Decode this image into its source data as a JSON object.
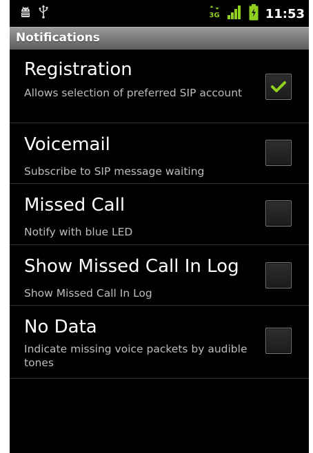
{
  "status_bar": {
    "time": "11:53",
    "network_label": "3G",
    "icons": [
      "android-debug-icon",
      "usb-icon",
      "network-3g-icon",
      "signal-strength-icon",
      "battery-icon"
    ]
  },
  "header": {
    "title": "Notifications"
  },
  "preferences": [
    {
      "title": "Registration",
      "summary": "Allows selection of preferred SIP account",
      "checked": true
    },
    {
      "title": "Voicemail",
      "summary": "Subscribe to SIP message waiting",
      "checked": false
    },
    {
      "title": "Missed Call",
      "summary": "Notify with blue LED",
      "checked": false
    },
    {
      "title": "Show Missed Call In Log",
      "summary": "Show Missed Call In Log",
      "checked": false
    },
    {
      "title": "No Data",
      "summary": "Indicate missing voice packets by audible tones",
      "checked": false
    }
  ],
  "colors": {
    "background": "#000000",
    "title_bar": "#7a7a7a",
    "check_green": "#8fd11e",
    "divider": "#333333",
    "summary_text": "#bdbdbd"
  }
}
